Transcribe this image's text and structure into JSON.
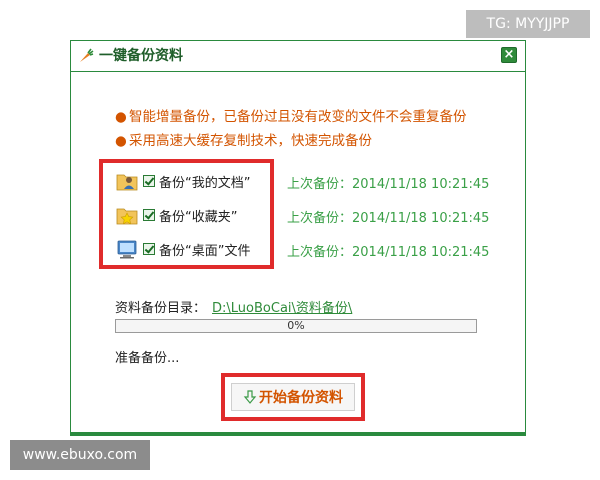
{
  "watermarks": {
    "top_right": "TG: MYYJJPP",
    "bottom_left": "www.ebuxo.com"
  },
  "dialog": {
    "title": "一键备份资料",
    "close_label": "×",
    "bullets": [
      "智能增量备份，已备份过且没有改变的文件不会重复备份",
      "采用高速大缓存复制技术，快速完成备份"
    ],
    "items": [
      {
        "label": "备份“我的文档”",
        "last_backup": "上次备份：2014/11/18 10:21:45",
        "checked": true,
        "icon": "user-folder-icon"
      },
      {
        "label": "备份“收藏夹”",
        "last_backup": "上次备份：2014/11/18 10:21:45",
        "checked": true,
        "icon": "favorites-folder-icon"
      },
      {
        "label": "备份“桌面”文件",
        "last_backup": "上次备份：2014/11/18 10:21:45",
        "checked": true,
        "icon": "desktop-icon"
      }
    ],
    "directory_label": "资料备份目录：",
    "directory_path": "D:\\LuoBoCai\\资料备份\\",
    "progress": {
      "percent": 0,
      "text": "0%"
    },
    "status_text": "准备备份...",
    "start_button_label": "开始备份资料",
    "colors": {
      "accent": "#2a8a3e",
      "bullet_text": "#d35400",
      "time_text": "#3aa047",
      "highlight": "#e02b2b"
    }
  }
}
